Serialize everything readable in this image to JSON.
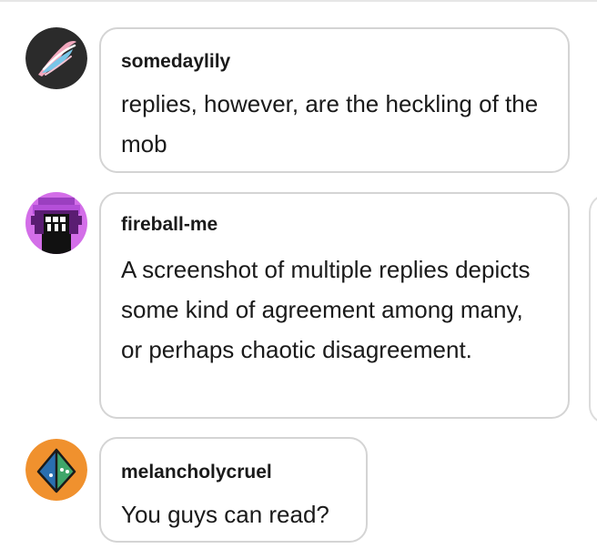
{
  "replies": [
    {
      "username": "somedaylily",
      "text": "replies, however, are the heckling of the mob",
      "avatar_icon": "feather-icon",
      "avatar_colors": [
        "#2b2b2b",
        "#f2a7bd",
        "#79c6e8"
      ]
    },
    {
      "username": "fireball-me",
      "text": "A screenshot of multiple replies depicts some kind of agreement among many, or perhaps chaotic disagreement.",
      "avatar_icon": "pixel-creature-icon",
      "avatar_colors": [
        "#d36ee8",
        "#5a1d72",
        "#111111"
      ]
    },
    {
      "username": "melancholycruel",
      "text": "You guys can read?",
      "avatar_icon": "octahedron-icon",
      "avatar_colors": [
        "#f0912e",
        "#2a6fb0",
        "#3fa66a"
      ]
    }
  ]
}
